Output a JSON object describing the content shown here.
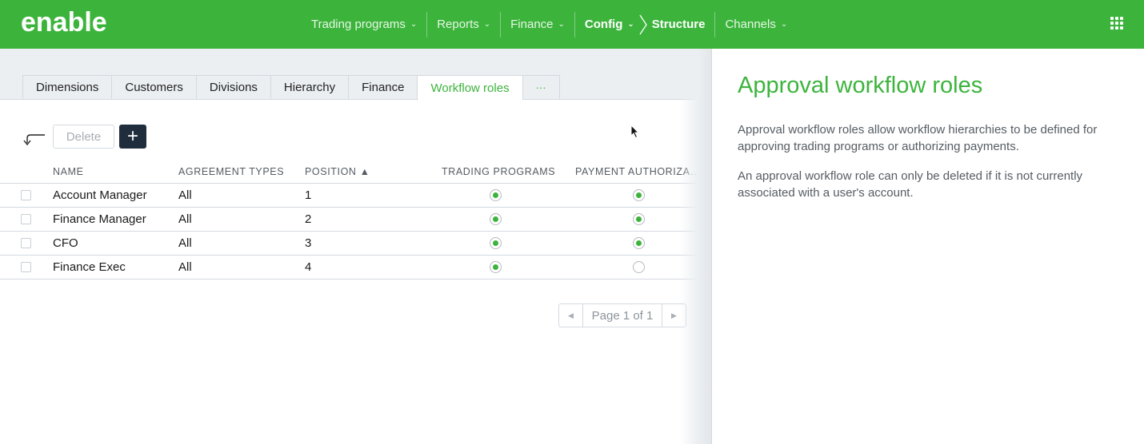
{
  "header": {
    "logo_text": "enable",
    "nav": [
      {
        "label": "Trading programs",
        "has_dropdown": true
      },
      {
        "label": "Reports",
        "has_dropdown": true
      },
      {
        "label": "Finance",
        "has_dropdown": true
      },
      {
        "label": "Config",
        "has_dropdown": true
      },
      {
        "label": "Structure",
        "has_dropdown": false
      },
      {
        "label": "Channels",
        "has_dropdown": true
      }
    ],
    "apps_icon": "grid-icon"
  },
  "tabs": [
    {
      "label": "Dimensions"
    },
    {
      "label": "Customers"
    },
    {
      "label": "Divisions"
    },
    {
      "label": "Hierarchy"
    },
    {
      "label": "Finance"
    },
    {
      "label": "Workflow roles",
      "active": true
    },
    {
      "label": "···"
    }
  ],
  "toolbar": {
    "delete_label": "Delete",
    "add_label": "+"
  },
  "table": {
    "columns": [
      "NAME",
      "AGREEMENT TYPES",
      "POSITION ▲",
      "TRADING PROGRAMS",
      "PAYMENT AUTHORIZA…"
    ],
    "rows": [
      {
        "name": "Account Manager",
        "agreement_types": "All",
        "position": "1",
        "trading_programs": true,
        "payment_authorization": true
      },
      {
        "name": "Finance Manager",
        "agreement_types": "All",
        "position": "2",
        "trading_programs": true,
        "payment_authorization": true
      },
      {
        "name": "CFO",
        "agreement_types": "All",
        "position": "3",
        "trading_programs": true,
        "payment_authorization": true
      },
      {
        "name": "Finance Exec",
        "agreement_types": "All",
        "position": "4",
        "trading_programs": true,
        "payment_authorization": false
      }
    ]
  },
  "pager": {
    "label": "Page 1 of 1"
  },
  "panel": {
    "title": "Approval workflow roles",
    "paragraphs": [
      "Approval workflow roles allow workflow hierarchies to be defined for approving trading programs or authorizing payments.",
      "An approval workflow role can only be deleted if it is not currently associated with a user's account."
    ]
  },
  "colors": {
    "brand_green": "#3cb43c",
    "dark_button": "#1f2d3d"
  }
}
